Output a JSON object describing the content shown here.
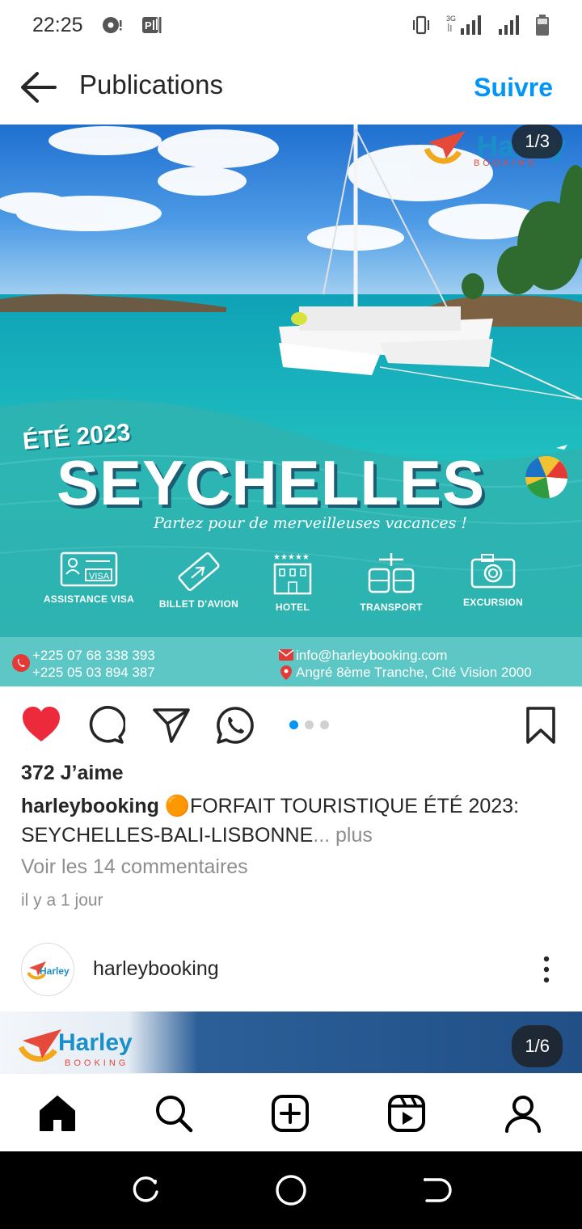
{
  "status_bar": {
    "time": "22:25",
    "network": "3G",
    "icons": [
      "media-icon",
      "app-notification-icon",
      "vibrate-icon",
      "signal-icon",
      "signal-icon-2",
      "battery-icon"
    ]
  },
  "header": {
    "title": "Publications",
    "back_icon": "arrow-left-icon",
    "follow_label": "Suivre"
  },
  "post": {
    "media_counter": "1/3",
    "image": {
      "brand_name": "Harley",
      "brand_sub": "BOOKING",
      "season": "ÉTÉ 2023",
      "destination": "SEYCHELLES",
      "tagline": "Partez pour de merveilleuses vacances !",
      "services": [
        {
          "label": "ASSISTANCE VISA",
          "icon": "visa-icon"
        },
        {
          "label": "BILLET D'AVION",
          "icon": "plane-ticket-icon"
        },
        {
          "label": "HOTEL",
          "icon": "hotel-icon"
        },
        {
          "label": "TRANSPORT",
          "icon": "transport-icon"
        },
        {
          "label": "EXCURSION",
          "icon": "camera-icon"
        }
      ],
      "phone_1": "+225 07 68 338 393",
      "phone_2": "+225 05 03 894 387",
      "email": "info@harleybooking.com",
      "address": "Angré 8ème Tranche, Cité Vision 2000"
    },
    "actions": {
      "like_icon": "heart-filled-icon",
      "comment_icon": "comment-icon",
      "share_icon": "send-icon",
      "whatsapp_icon": "whatsapp-icon",
      "save_icon": "bookmark-icon",
      "carousel_dots": 3,
      "active_dot": 1
    },
    "likes": "372 J’aime",
    "caption_user": "harleybooking",
    "caption_emoji": "🟠",
    "caption_text": "FORFAIT TOURISTIQUE ÉTÉ 2023: SEYCHELLES-BALI-LISBONNE",
    "caption_more": "... plus",
    "comments_link": "Voir les 14 commentaires",
    "time_ago": "il y a 1 jour"
  },
  "next_post": {
    "username": "harleybooking",
    "avatar_text": "Harley",
    "media_counter": "1/6",
    "brand_name": "Harley",
    "brand_sub": "BOOKING"
  },
  "bottom_nav": [
    "home-icon",
    "search-icon",
    "create-icon",
    "reels-icon",
    "profile-icon"
  ],
  "system_nav": [
    "recents-icon",
    "home-circle-icon",
    "back-icon"
  ],
  "colors": {
    "accent": "#0095f6",
    "like": "#ed2a3c",
    "sea": "#2ab6b4",
    "contact_bar": "#5cc7c4"
  }
}
